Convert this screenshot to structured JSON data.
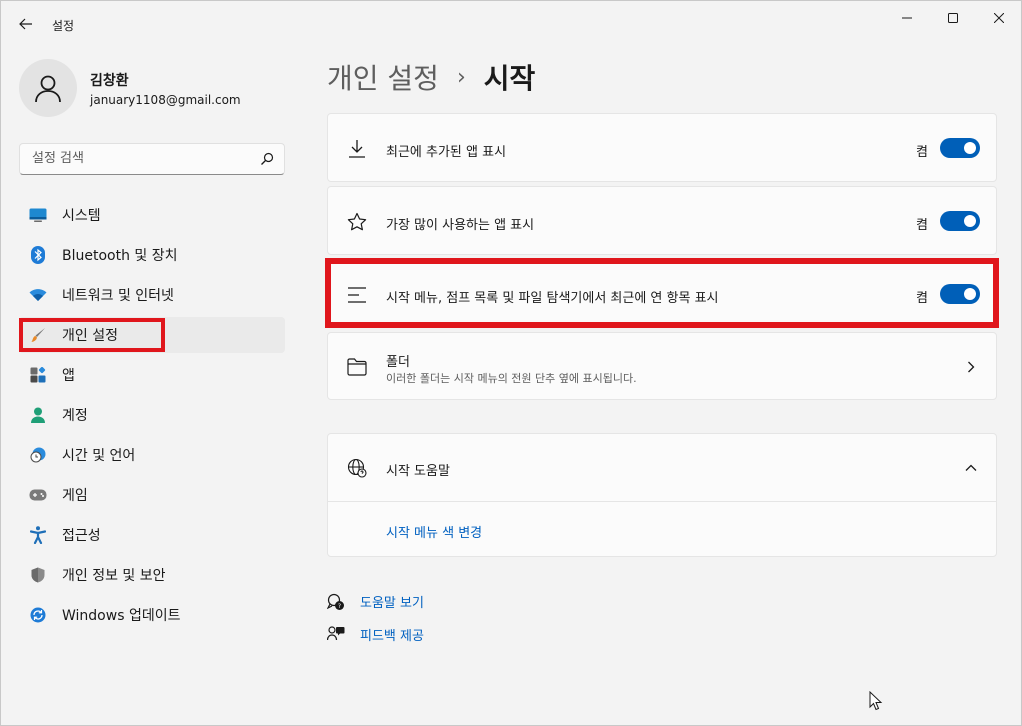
{
  "window": {
    "title": "설정"
  },
  "profile": {
    "name": "김창환",
    "email": "january1108@gmail.com"
  },
  "search": {
    "placeholder": "설정 검색"
  },
  "sidebar": {
    "items": [
      {
        "label": "시스템",
        "icon": "monitor-icon"
      },
      {
        "label": "Bluetooth 및 장치",
        "icon": "bluetooth-icon"
      },
      {
        "label": "네트워크 및 인터넷",
        "icon": "wifi-icon"
      },
      {
        "label": "개인 설정",
        "icon": "brush-icon",
        "active": true
      },
      {
        "label": "앱",
        "icon": "apps-icon"
      },
      {
        "label": "계정",
        "icon": "person-icon"
      },
      {
        "label": "시간 및 언어",
        "icon": "clock-globe-icon"
      },
      {
        "label": "게임",
        "icon": "gamepad-icon"
      },
      {
        "label": "접근성",
        "icon": "accessibility-icon"
      },
      {
        "label": "개인 정보 및 보안",
        "icon": "shield-icon"
      },
      {
        "label": "Windows 업데이트",
        "icon": "update-icon"
      }
    ]
  },
  "breadcrumb": {
    "parent": "개인 설정",
    "separator": "›",
    "current": "시작"
  },
  "settings": {
    "recent_apps": {
      "label": "최근에 추가된 앱 표시",
      "state": "켬",
      "on": true
    },
    "most_used": {
      "label": "가장 많이 사용하는 앱 표시",
      "state": "켬",
      "on": true
    },
    "recent_items": {
      "label": "시작 메뉴, 점프 목록 및 파일 탐색기에서 최근에 연 항목 표시",
      "state": "켬",
      "on": true
    },
    "folders": {
      "label": "폴더",
      "description": "이러한 폴더는 시작 메뉴의 전원 단추 옆에 표시됩니다."
    }
  },
  "help_section": {
    "title": "시작 도움말",
    "link": "시작 메뉴 색 변경"
  },
  "footer_links": {
    "get_help": "도움말 보기",
    "feedback": "피드백 제공"
  },
  "colors": {
    "accent": "#005fb8",
    "highlight": "#e0161c"
  }
}
